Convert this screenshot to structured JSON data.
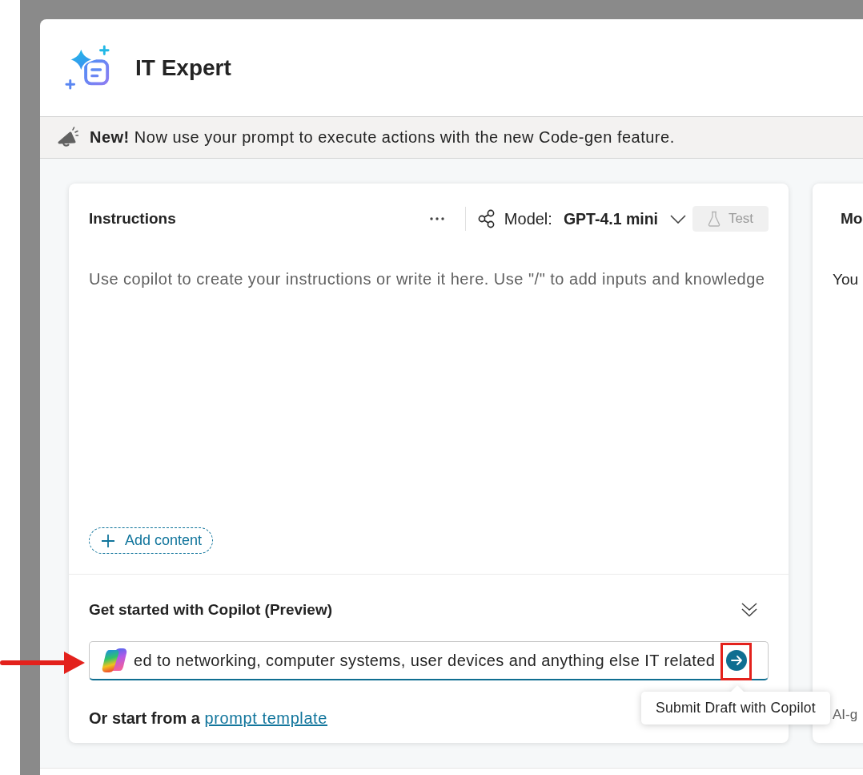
{
  "dialog": {
    "title": "IT Expert"
  },
  "banner": {
    "text": "**New!** Now use your prompt to execute actions with the new Code-gen feature."
  },
  "instructions": {
    "title": "Instructions",
    "model_label": "Model:",
    "model": "GPT-4.1 mini",
    "test_button": {
      "label": "Test",
      "disabled": true
    },
    "placeholder": "Use copilot to create your instructions or write it here. Use \"/\" to add inputs and knowledge",
    "add_content": "Add content"
  },
  "copilot": {
    "title": "Get started with Copilot (Preview)",
    "prompt_value": "ed to networking, computer systems, user devices and anything else IT related",
    "submit_tooltip": "Submit Draft with Copilot",
    "template_hint": {
      "text": "Or start from a",
      "link": "prompt template"
    }
  },
  "side_card": {
    "title": "Mo",
    "text": "You",
    "footer": "AI-g"
  },
  "annotations": {
    "pointer_arrow": true,
    "highlight_frame": true
  }
}
